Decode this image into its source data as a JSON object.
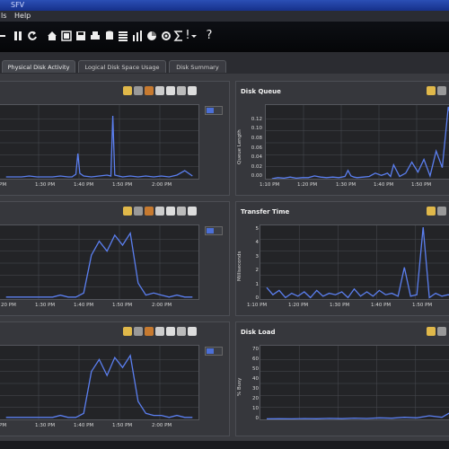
{
  "window": {
    "title": "SFV"
  },
  "menu": {
    "items": [
      "ls",
      "Help"
    ]
  },
  "toolbar": {
    "help_symbol": "?",
    "info_symbol": "!"
  },
  "tabs": [
    {
      "label": "Physical Disk Activity",
      "active": true
    },
    {
      "label": "Logical Disk Space Usage",
      "active": false
    },
    {
      "label": "Disk Summary",
      "active": false
    }
  ],
  "colors": {
    "series": "#5b7ff0",
    "grid": "#4a4c52",
    "plot_bg": "#232427"
  },
  "panels": {
    "top_left": {
      "title": "",
      "x_ticks": [
        "PM",
        "1:30 PM",
        "1:40 PM",
        "1:50 PM",
        "2:00 PM"
      ]
    },
    "disk_queue": {
      "title": "Disk Queue",
      "ylabel": "Queue Length",
      "y_ticks": [
        "0.12",
        "0.10",
        "0.08",
        "0.06",
        "0.04",
        "0.02",
        "0.00"
      ],
      "x_ticks": [
        "1:10 PM",
        "1:20 PM",
        "1:30 PM",
        "1:40 PM",
        "1:50 PM"
      ]
    },
    "mid_left": {
      "title": "",
      "x_ticks": [
        "20 PM",
        "1:30 PM",
        "1:40 PM",
        "1:50 PM",
        "2:00 PM"
      ]
    },
    "transfer_time": {
      "title": "Transfer Time",
      "ylabel": "Milliseconds",
      "y_ticks": [
        "5",
        "4",
        "3",
        "2",
        "1",
        "0"
      ],
      "x_ticks": [
        "1:10 PM",
        "1:20 PM",
        "1:30 PM",
        "1:40 PM",
        "1:50 PM"
      ]
    },
    "bottom_left": {
      "title": "",
      "x_ticks": [
        "PM",
        "1:30 PM",
        "1:40 PM",
        "1:50 PM",
        "2:00 PM"
      ]
    },
    "disk_load": {
      "title": "Disk Load",
      "ylabel": "% Busy",
      "y_ticks": [
        "70",
        "60",
        "50",
        "40",
        "30",
        "20",
        "10",
        "0"
      ]
    }
  },
  "chart_data": [
    {
      "type": "line",
      "title": "",
      "x": [
        1.2,
        1.22,
        1.24,
        1.26,
        1.28,
        1.3,
        1.32,
        1.34,
        1.36,
        1.37,
        1.38,
        1.385,
        1.39,
        1.4,
        1.42,
        1.44,
        1.46,
        1.47,
        1.475,
        1.48,
        1.49,
        1.5,
        1.52,
        1.54,
        1.56,
        1.58,
        1.6,
        1.62,
        1.64,
        1.66,
        1.68
      ],
      "values": [
        2,
        2,
        2,
        3,
        2,
        2,
        2,
        3,
        2,
        2,
        5,
        28,
        6,
        3,
        2,
        3,
        4,
        3,
        70,
        4,
        3,
        2,
        3,
        2,
        3,
        2,
        3,
        2,
        4,
        9,
        3
      ],
      "ylim": [
        0,
        80
      ]
    },
    {
      "type": "line",
      "title": "Disk Queue",
      "ylabel": "Queue Length",
      "x": [
        1.1,
        1.12,
        1.14,
        1.16,
        1.18,
        1.2,
        1.22,
        1.24,
        1.26,
        1.28,
        1.3,
        1.32,
        1.34,
        1.35,
        1.36,
        1.37,
        1.38,
        1.4,
        1.42,
        1.44,
        1.46,
        1.47,
        1.48,
        1.49,
        1.5,
        1.52,
        1.54,
        1.56,
        1.58,
        1.6,
        1.62,
        1.64,
        1.66,
        1.68,
        1.7
      ],
      "values": [
        0.0,
        0.002,
        0.001,
        0.003,
        0.001,
        0.002,
        0.002,
        0.005,
        0.003,
        0.002,
        0.003,
        0.002,
        0.004,
        0.015,
        0.005,
        0.003,
        0.002,
        0.003,
        0.004,
        0.01,
        0.006,
        0.008,
        0.01,
        0.004,
        0.025,
        0.004,
        0.01,
        0.03,
        0.012,
        0.035,
        0.005,
        0.05,
        0.02,
        0.13,
        0.09
      ],
      "ylim": [
        0,
        0.13
      ]
    },
    {
      "type": "line",
      "title": "",
      "x": [
        1.2,
        1.22,
        1.24,
        1.26,
        1.28,
        1.3,
        1.32,
        1.34,
        1.36,
        1.38,
        1.4,
        1.42,
        1.44,
        1.46,
        1.48,
        1.5,
        1.52,
        1.54,
        1.56,
        1.58,
        1.6,
        1.62,
        1.64,
        1.66,
        1.68
      ],
      "values": [
        1,
        1,
        1,
        1,
        1,
        1,
        1,
        2,
        1,
        1,
        3,
        22,
        29,
        24,
        32,
        27,
        33,
        8,
        2,
        3,
        2,
        1,
        2,
        1,
        1
      ],
      "ylim": [
        0,
        36
      ]
    },
    {
      "type": "line",
      "title": "Transfer Time",
      "ylabel": "Milliseconds",
      "x": [
        1.1,
        1.12,
        1.14,
        1.16,
        1.18,
        1.2,
        1.22,
        1.24,
        1.26,
        1.28,
        1.3,
        1.32,
        1.34,
        1.36,
        1.38,
        1.4,
        1.42,
        1.44,
        1.46,
        1.48,
        1.5,
        1.52,
        1.54,
        1.56,
        1.58,
        1.6,
        1.62,
        1.64,
        1.66,
        1.68,
        1.7
      ],
      "values": [
        0.8,
        0.3,
        0.6,
        0.1,
        0.4,
        0.2,
        0.5,
        0.1,
        0.6,
        0.2,
        0.4,
        0.3,
        0.5,
        0.1,
        0.7,
        0.2,
        0.5,
        0.2,
        0.6,
        0.3,
        0.4,
        0.2,
        2.2,
        0.2,
        0.3,
        5.0,
        0.1,
        0.4,
        0.2,
        0.3,
        0.2
      ],
      "ylim": [
        0,
        5
      ]
    },
    {
      "type": "line",
      "title": "",
      "x": [
        1.2,
        1.22,
        1.24,
        1.26,
        1.28,
        1.3,
        1.32,
        1.34,
        1.36,
        1.38,
        1.4,
        1.42,
        1.44,
        1.46,
        1.48,
        1.5,
        1.52,
        1.54,
        1.56,
        1.58,
        1.6,
        1.62,
        1.64,
        1.66,
        1.68
      ],
      "values": [
        1,
        1,
        1,
        1,
        1,
        1,
        1,
        2,
        1,
        1,
        3,
        24,
        30,
        22,
        31,
        26,
        32,
        9,
        3,
        2,
        2,
        1,
        2,
        1,
        1
      ],
      "ylim": [
        0,
        36
      ]
    },
    {
      "type": "line",
      "title": "Disk Load",
      "ylabel": "% Busy",
      "x": [
        1.1,
        1.14,
        1.18,
        1.22,
        1.26,
        1.3,
        1.34,
        1.38,
        1.42,
        1.46,
        1.5,
        1.54,
        1.58,
        1.62,
        1.66,
        1.7
      ],
      "values": [
        0.5,
        0.6,
        0.5,
        0.8,
        0.6,
        1.0,
        0.7,
        1.2,
        0.9,
        1.5,
        1.1,
        2.0,
        1.5,
        3.5,
        2.0,
        9.0
      ],
      "ylim": [
        0,
        70
      ]
    }
  ]
}
